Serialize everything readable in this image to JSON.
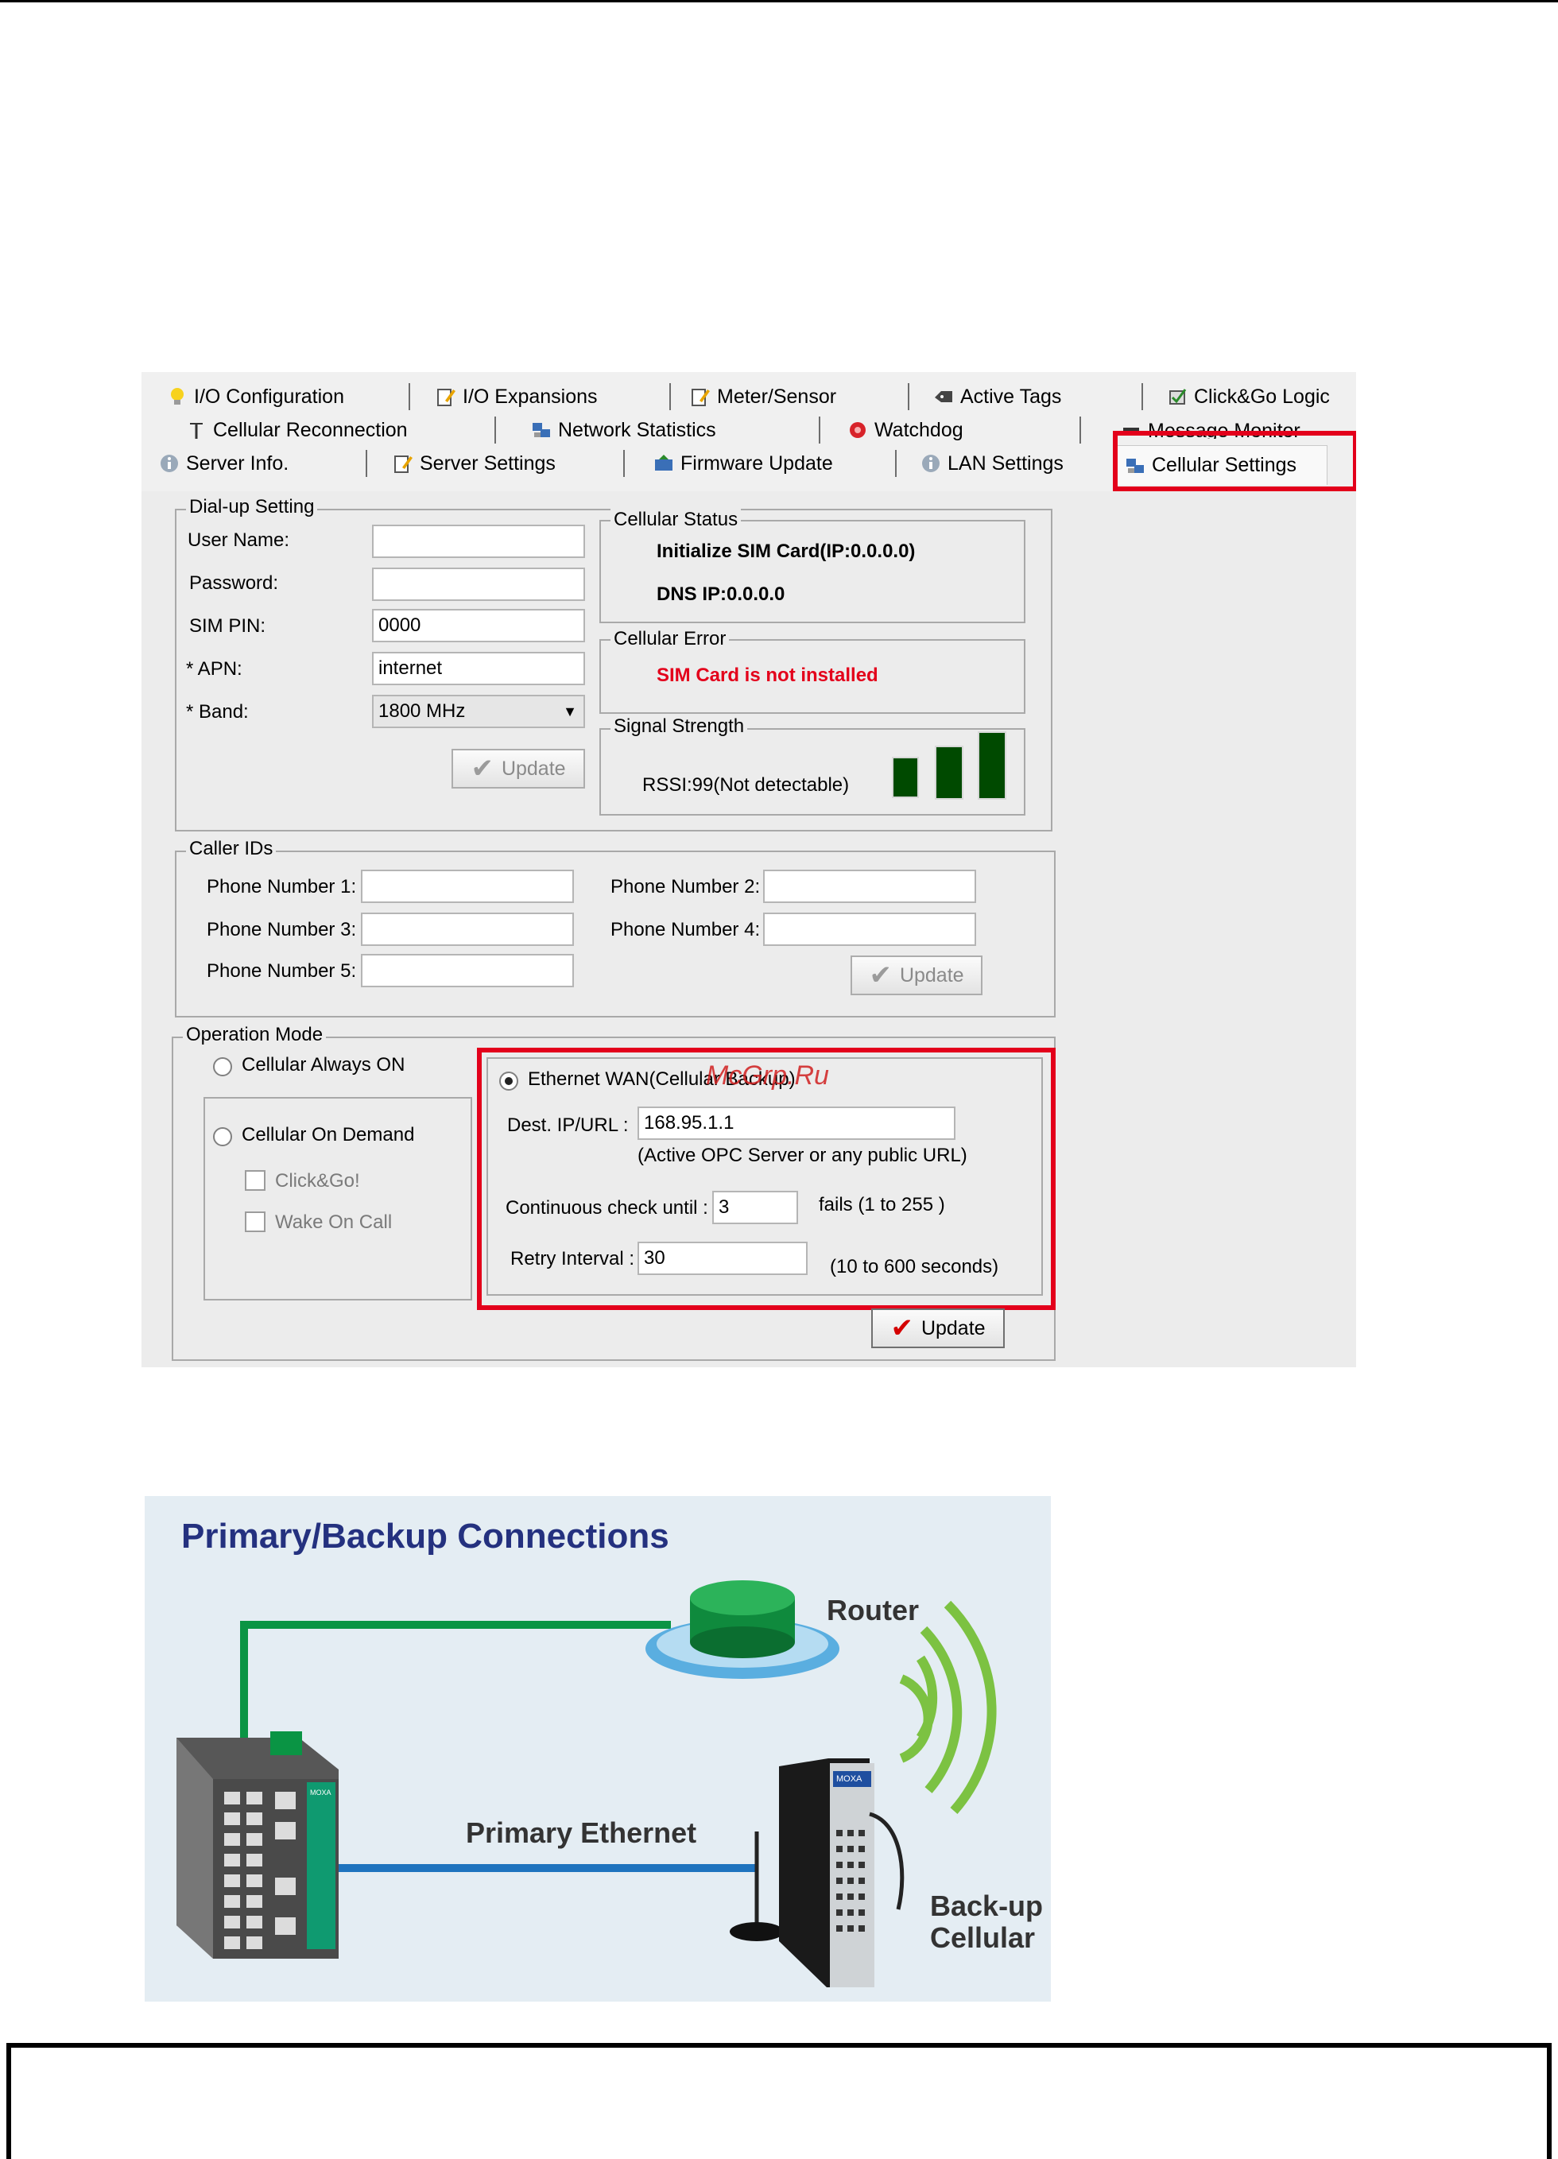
{
  "tabs": {
    "row1": [
      "I/O Configuration",
      "I/O Expansions",
      "Meter/Sensor",
      "Active Tags",
      "Click&Go Logic"
    ],
    "row2": [
      "Cellular Reconnection",
      "Network Statistics",
      "Watchdog",
      "Message Monitor"
    ],
    "row3": [
      "Server Info.",
      "Server Settings",
      "Firmware Update",
      "LAN Settings",
      "Cellular Settings"
    ]
  },
  "dialup": {
    "title": "Dial-up Setting",
    "user_label": "User Name:",
    "password_label": "Password:",
    "simpin_label": "SIM PIN:",
    "simpin_value": "0000",
    "apn_label": "* APN:",
    "apn_value": "internet",
    "band_label": "* Band:",
    "band_value": "1800 MHz",
    "update_label": "Update"
  },
  "status": {
    "title": "Cellular Status",
    "line1": "Initialize SIM Card(IP:0.0.0.0)",
    "line2": "DNS IP:0.0.0.0"
  },
  "error": {
    "title": "Cellular Error",
    "message": "SIM Card is not installed"
  },
  "signal": {
    "title": "Signal Strength",
    "rssi": "RSSI:99(Not detectable)"
  },
  "callers": {
    "title": "Caller IDs",
    "p1": "Phone Number 1:",
    "p2": "Phone Number 2:",
    "p3": "Phone Number 3:",
    "p4": "Phone Number 4:",
    "p5": "Phone Number 5:",
    "update_label": "Update"
  },
  "opmode": {
    "title": "Operation Mode",
    "always_on": "Cellular Always ON",
    "on_demand": "Cellular On Demand",
    "clickgo": "Click&Go!",
    "wake": "Wake On Call",
    "ethernet_wan": "Ethernet WAN(Cellular Backup)",
    "dest_label": "Dest. IP/URL :",
    "dest_value": "168.95.1.1",
    "dest_hint": "(Active OPC Server or any public URL)",
    "check_label": "Continuous check until :",
    "check_value": "3",
    "check_hint": "fails (1 to 255 )",
    "retry_label": "Retry Interval :",
    "retry_value": "30",
    "retry_hint": "(10 to 600 seconds)",
    "update_label": "Update"
  },
  "watermark": "McGrp.Ru",
  "diagram": {
    "title": "Primary/Backup Connections",
    "router": "Router",
    "primary": "Primary Ethernet",
    "backup_line1": "Back-up",
    "backup_line2": "Cellular",
    "switch_brand": "MOXA",
    "device_brand": "MOXA"
  },
  "colors": {
    "highlight": "#e3001b",
    "error_text": "#e3001b",
    "signal_bar": "#004a00",
    "diagram_title": "#24317f",
    "green_link": "#0a9444",
    "blue_link": "#1e73be"
  }
}
